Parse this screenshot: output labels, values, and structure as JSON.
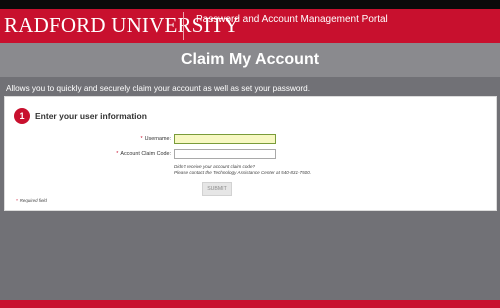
{
  "header": {
    "logo_text": "RADFORD UNIVERSITY",
    "portal_title": "Password and Account Management Portal"
  },
  "page": {
    "title": "Claim My Account",
    "description": "Allows you to quickly and securely claim your account as well as set your password."
  },
  "step": {
    "number": "1",
    "heading": "Enter your user information"
  },
  "form": {
    "required_marker": "*",
    "username": {
      "label": "Username:",
      "value": "",
      "placeholder": ""
    },
    "claim_code": {
      "label": "Account Claim Code:",
      "value": "",
      "placeholder": ""
    },
    "help_line1": "Didn't receive your account claim code?",
    "help_line2": "Please contact the Technology Assistance Center at 540-831-7500.",
    "submit_label": "SUBMIT",
    "required_note": "Required field"
  },
  "colors": {
    "brand_red": "#c8102e",
    "title_bar_gray": "#8a8a8e",
    "background_gray": "#717176",
    "active_field": "#f7f8c2"
  }
}
